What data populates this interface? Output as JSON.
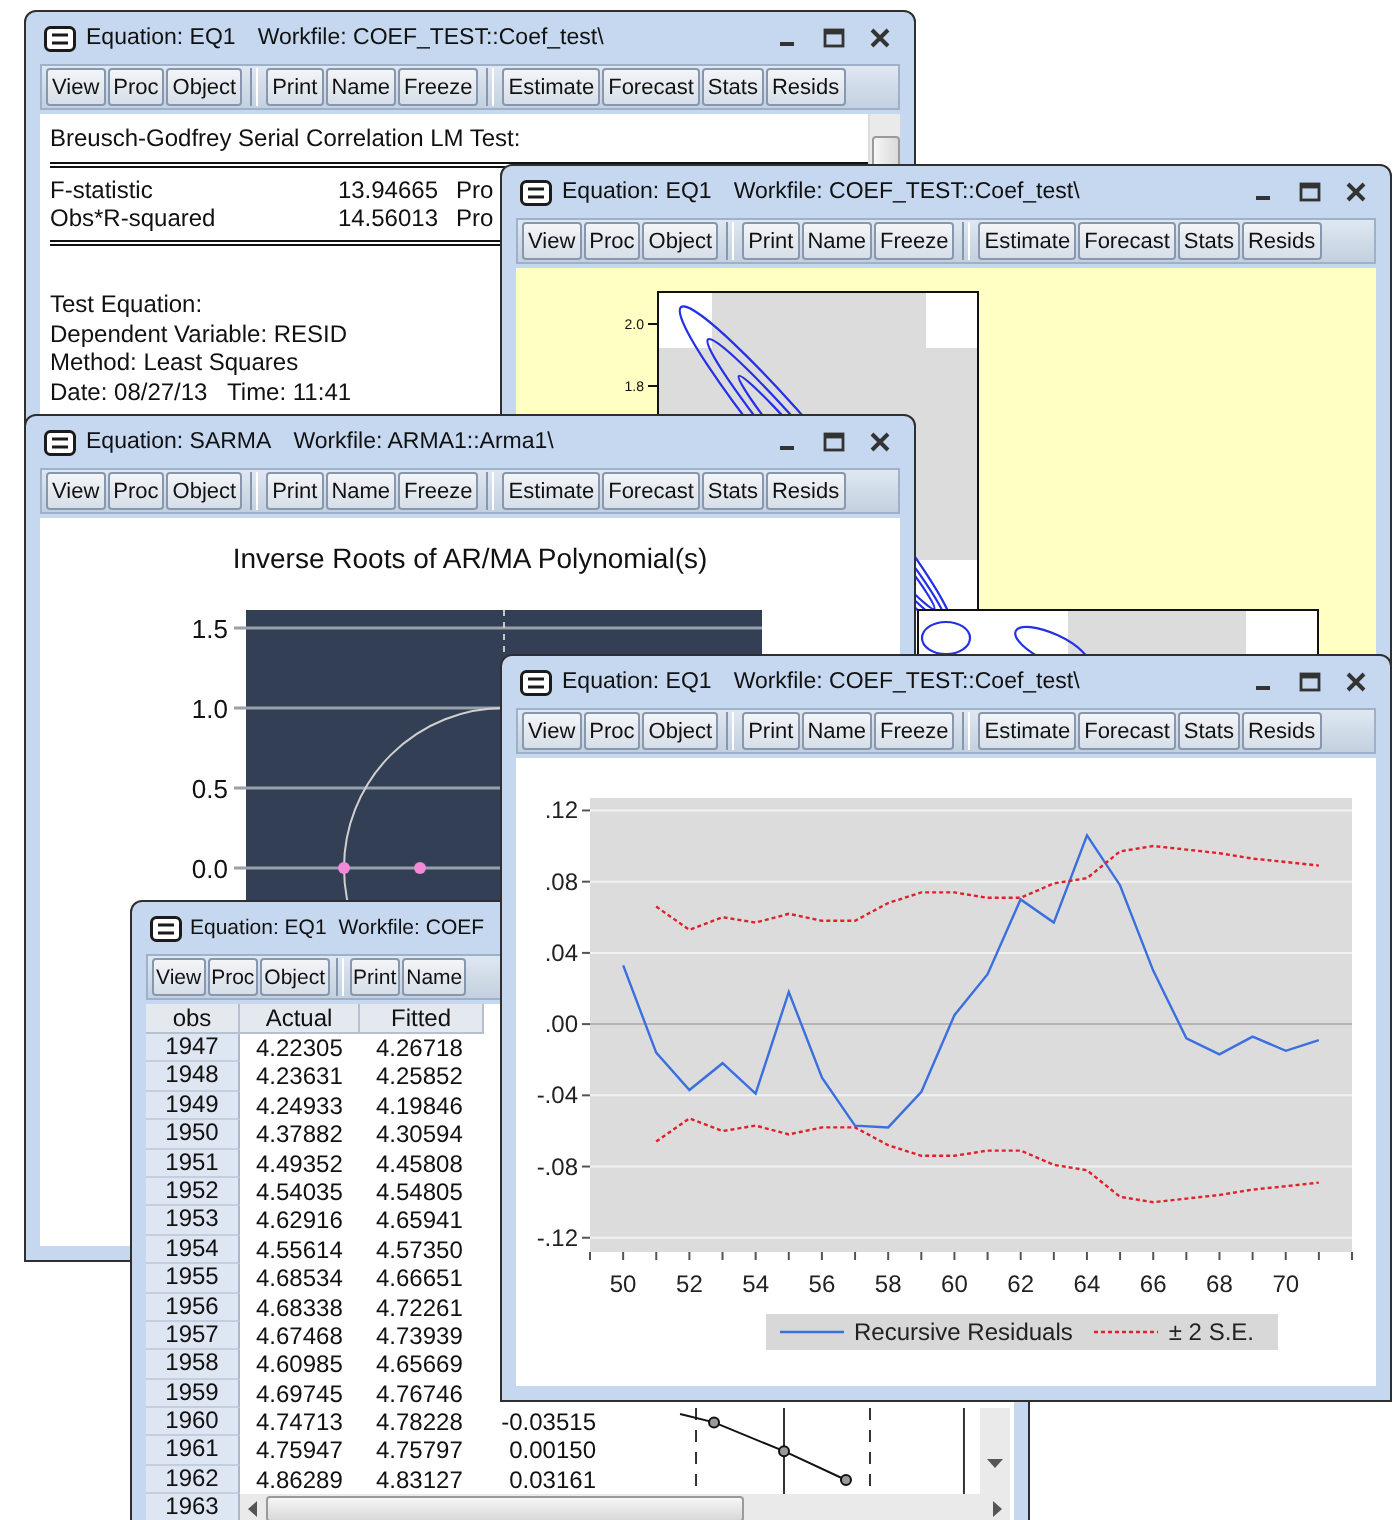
{
  "windows": [
    {
      "kind": "text_output",
      "title": "Equation: EQ1",
      "workfile": "Workfile: COEF_TEST::Coef_test\\",
      "toolbar": [
        [
          "View",
          "Proc",
          "Object"
        ],
        [
          "Print",
          "Name",
          "Freeze"
        ],
        [
          "Estimate",
          "Forecast",
          "Stats",
          "Resids"
        ]
      ],
      "heading": "Breusch-Godfrey Serial Correlation LM Test:",
      "stats": [
        {
          "label": "F-statistic",
          "value": "13.94665",
          "prob": "Pro"
        },
        {
          "label": "Obs*R-squared",
          "value": "14.56013",
          "prob": "Pro"
        }
      ],
      "lines": [
        "Test Equation:",
        "Dependent Variable: RESID",
        "Method: Least Squares",
        "Date: 08/27/13   Time: 11:41"
      ]
    },
    {
      "kind": "contour",
      "title": "Equation: EQ1",
      "workfile": "Workfile: COEF_TEST::Coef_test\\",
      "toolbar": [
        [
          "View",
          "Proc",
          "Object"
        ],
        [
          "Print",
          "Name",
          "Freeze"
        ],
        [
          "Estimate",
          "Forecast",
          "Stats",
          "Resids"
        ]
      ],
      "y_ticks": [
        "2.0",
        "1.8"
      ]
    },
    {
      "kind": "roots",
      "title": "Equation: SARMA",
      "workfile": "Workfile: ARMA1::Arma1\\",
      "toolbar": [
        [
          "View",
          "Proc",
          "Object"
        ],
        [
          "Print",
          "Name",
          "Freeze"
        ],
        [
          "Estimate",
          "Forecast",
          "Stats",
          "Resids"
        ]
      ],
      "chart_title": "Inverse Roots of AR/MA Polynomial(s)",
      "y_ticks": [
        "1.5",
        "1.0",
        "0.5",
        "0.0"
      ]
    },
    {
      "kind": "table",
      "title": "Equation: EQ1",
      "workfile": "Workfile: COEF",
      "toolbar": [
        [
          "View",
          "Proc",
          "Object"
        ],
        [
          "Print",
          "Name"
        ]
      ],
      "columns": [
        "obs",
        "Actual",
        "Fitted"
      ],
      "rows": [
        {
          "obs": "1947",
          "actual": "4.22305",
          "fitted": "4.26718"
        },
        {
          "obs": "1948",
          "actual": "4.23631",
          "fitted": "4.25852"
        },
        {
          "obs": "1949",
          "actual": "4.24933",
          "fitted": "4.19846"
        },
        {
          "obs": "1950",
          "actual": "4.37882",
          "fitted": "4.30594"
        },
        {
          "obs": "1951",
          "actual": "4.49352",
          "fitted": "4.45808"
        },
        {
          "obs": "1952",
          "actual": "4.54035",
          "fitted": "4.54805"
        },
        {
          "obs": "1953",
          "actual": "4.62916",
          "fitted": "4.65941"
        },
        {
          "obs": "1954",
          "actual": "4.55614",
          "fitted": "4.57350"
        },
        {
          "obs": "1955",
          "actual": "4.68534",
          "fitted": "4.66651"
        },
        {
          "obs": "1956",
          "actual": "4.68338",
          "fitted": "4.72261"
        },
        {
          "obs": "1957",
          "actual": "4.67468",
          "fitted": "4.73939"
        },
        {
          "obs": "1958",
          "actual": "4.60985",
          "fitted": "4.65669"
        },
        {
          "obs": "1959",
          "actual": "4.69745",
          "fitted": "4.76746"
        },
        {
          "obs": "1960",
          "actual": "4.74713",
          "fitted": "4.78228",
          "residual": "-0.03515"
        },
        {
          "obs": "1961",
          "actual": "4.75947",
          "fitted": "4.75797",
          "residual": "0.00150"
        },
        {
          "obs": "1962",
          "actual": "4.86289",
          "fitted": "4.83127",
          "residual": "0.03161"
        },
        {
          "obs": "1963"
        }
      ]
    },
    {
      "kind": "line_chart",
      "title": "Equation: EQ1",
      "workfile": "Workfile: COEF_TEST::Coef_test\\",
      "toolbar": [
        [
          "View",
          "Proc",
          "Object"
        ],
        [
          "Print",
          "Name",
          "Freeze"
        ],
        [
          "Estimate",
          "Forecast",
          "Stats",
          "Resids"
        ]
      ],
      "chart_data": {
        "type": "line",
        "grid": true,
        "x": [
          50,
          51,
          52,
          53,
          54,
          55,
          56,
          57,
          58,
          59,
          60,
          61,
          62,
          63,
          64,
          65,
          66,
          67,
          68,
          69,
          70,
          71
        ],
        "xlim": [
          49,
          72
        ],
        "ylim": [
          -0.128,
          0.127
        ],
        "xticks": [
          50,
          52,
          54,
          56,
          58,
          60,
          62,
          64,
          66,
          68,
          70
        ],
        "yticks": [
          {
            "value": 0.12,
            "label": ".12"
          },
          {
            "value": 0.08,
            "label": ".08"
          },
          {
            "value": 0.04,
            "label": ".04"
          },
          {
            "value": 0,
            "label": ".00"
          },
          {
            "value": -0.04,
            "label": "-.04"
          },
          {
            "value": -0.08,
            "label": "-.08"
          },
          {
            "value": -0.12,
            "label": "-.12"
          }
        ],
        "series": [
          {
            "name": "Recursive Residuals",
            "color": "#3a6fe0",
            "line_style": "solid",
            "values": [
              0.033,
              -0.016,
              -0.037,
              -0.022,
              -0.039,
              0.018,
              -0.03,
              -0.057,
              -0.058,
              -0.038,
              0.005,
              0.028,
              0.07,
              0.057,
              0.106,
              0.078,
              0.03,
              -0.008,
              -0.017,
              -0.007,
              -0.015,
              -0.009
            ]
          },
          {
            "name": "± 2 S.E.",
            "color": "#e0202a",
            "line_style": "dashed",
            "values": [
              null,
              0.066,
              0.053,
              0.06,
              0.057,
              0.062,
              0.058,
              0.058,
              0.068,
              0.074,
              0.074,
              0.071,
              0.071,
              0.079,
              0.082,
              0.097,
              0.1,
              0.098,
              0.096,
              0.093,
              0.091,
              0.089
            ]
          },
          {
            "color": "#e0202a",
            "line_style": "dashed",
            "values": [
              null,
              -0.066,
              -0.053,
              -0.06,
              -0.057,
              -0.062,
              -0.058,
              -0.058,
              -0.068,
              -0.074,
              -0.074,
              -0.071,
              -0.071,
              -0.079,
              -0.082,
              -0.097,
              -0.1,
              -0.098,
              -0.096,
              -0.093,
              -0.091,
              -0.089
            ]
          }
        ]
      }
    }
  ]
}
